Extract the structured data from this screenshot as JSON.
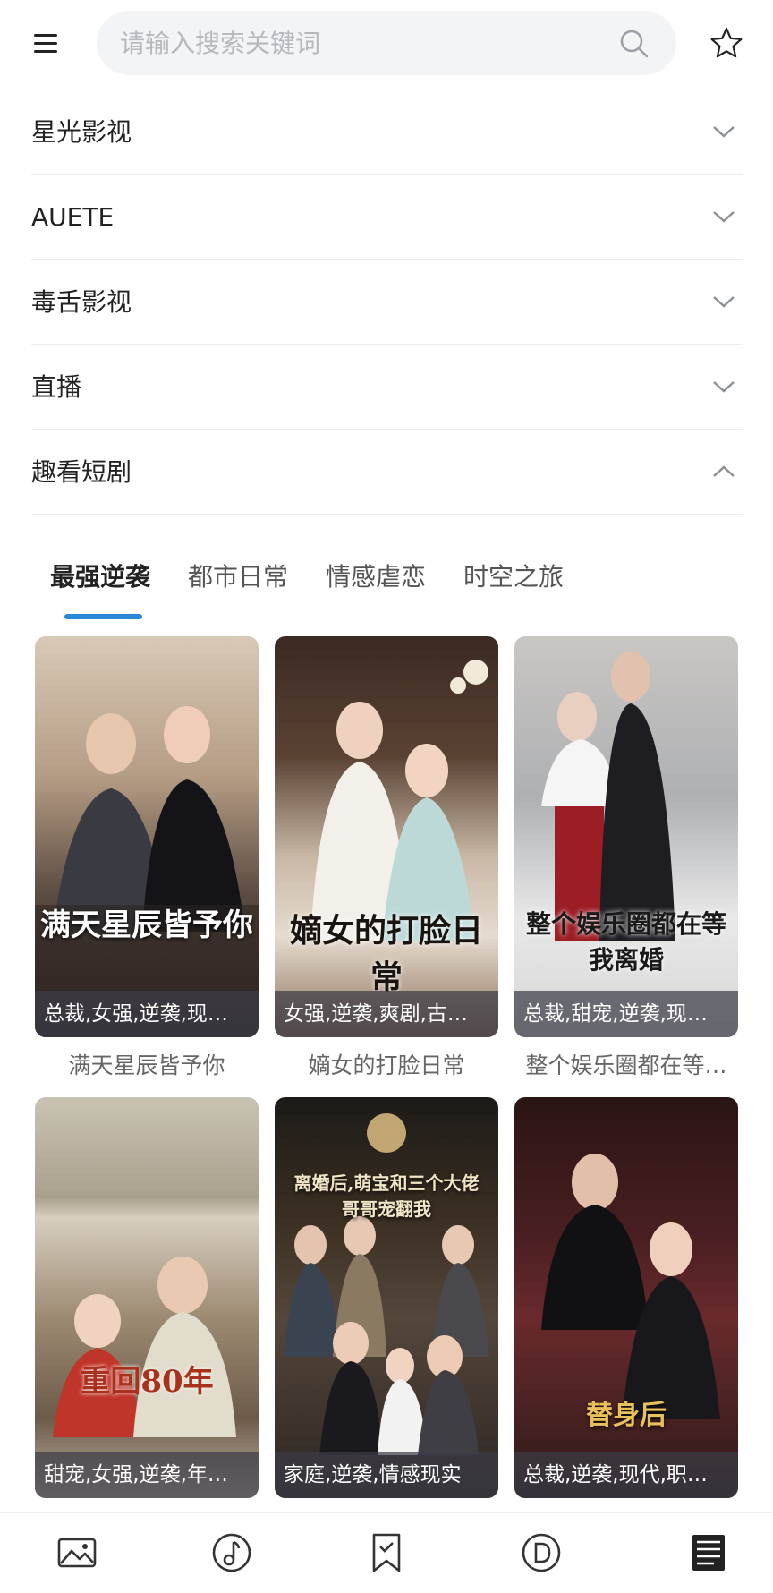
{
  "search": {
    "placeholder": "请输入搜索关键词"
  },
  "icons": {
    "menu": "menu-icon",
    "search": "search-icon",
    "star": "star-icon",
    "chevron_down": "chevron-down-icon",
    "chevron_up": "chevron-up-icon"
  },
  "accordion": [
    {
      "label": "星光影视",
      "expanded": false
    },
    {
      "label": "AUETE",
      "expanded": false
    },
    {
      "label": "毒舌影视",
      "expanded": false
    },
    {
      "label": "直播",
      "expanded": false
    },
    {
      "label": "趣看短剧",
      "expanded": true
    }
  ],
  "tabs": [
    {
      "label": "最强逆袭",
      "active": true
    },
    {
      "label": "都市日常",
      "active": false
    },
    {
      "label": "情感虐恋",
      "active": false
    },
    {
      "label": "时空之旅",
      "active": false
    }
  ],
  "colors": {
    "accent": "#2b88d9",
    "tag_bg": "rgba(60,60,70,0.72)"
  },
  "cards": [
    {
      "title": "满天星辰皆予你",
      "tags": "总裁,女强,逆袭,现…",
      "poster_text": "满天星辰皆予你"
    },
    {
      "title": "嫡女的打脸日常",
      "tags": "女强,逆袭,爽剧,古…",
      "poster_text": "嫡女的打脸日常"
    },
    {
      "title": "整个娱乐圈都在等…",
      "tags": "总裁,甜宠,逆袭,现…",
      "poster_text": "整个娱乐圈都在等我离婚"
    },
    {
      "title": "",
      "tags": "甜宠,女强,逆袭,年…",
      "poster_text": "重回80年"
    },
    {
      "title": "",
      "tags": "家庭,逆袭,情感现实",
      "poster_text": "离婚后,萌宝和三个大佬哥哥宠翻我"
    },
    {
      "title": "",
      "tags": "总裁,逆袭,现代,职…",
      "poster_text": "替身后"
    }
  ],
  "bottom_nav": [
    {
      "name": "image-icon",
      "active": false
    },
    {
      "name": "music-icon",
      "active": false
    },
    {
      "name": "bookmark-icon",
      "active": false
    },
    {
      "name": "d-circle-icon",
      "active": false
    },
    {
      "name": "book-icon",
      "active": true
    }
  ]
}
